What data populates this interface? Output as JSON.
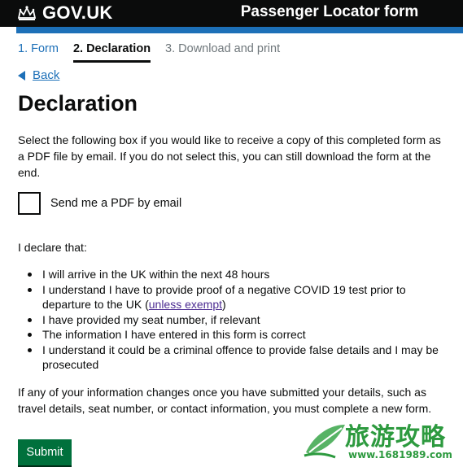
{
  "header": {
    "logo_text": "GOV.UK",
    "service_name": "Passenger Locator form"
  },
  "steps": [
    {
      "label": "1. Form"
    },
    {
      "label": "2. Declaration"
    },
    {
      "label": "3. Download and print"
    }
  ],
  "back_link": "Back",
  "page_title": "Declaration",
  "intro_text": "Select the following box if you would like to receive a copy of this completed form as a PDF file by email. If you do not select this, you can still download the form at the end.",
  "checkbox": {
    "label": "Send me a PDF by email",
    "checked": false
  },
  "declare_intro": "I declare that:",
  "declarations": {
    "item1": "I will arrive in the UK within the next 48 hours",
    "item2_before": "I understand I have to provide proof of a negative COVID 19 test prior to departure to the UK (",
    "item2_link": "unless exempt",
    "item2_after": ")",
    "item3": "I have provided my seat number, if relevant",
    "item4": "The information I have entered in this form is correct",
    "item5": "I understand it could be a criminal offence to provide false details and I may be prosecuted"
  },
  "outro_text": "If any of your information changes once you have submitted your details, such as travel details, seat number, or contact information, you must complete a new form.",
  "submit_label": "Submit",
  "watermark": {
    "title": "旅游攻略",
    "url": "www.1681989.com"
  },
  "colors": {
    "header_bg": "#0b0c0c",
    "accent_blue": "#1d70b8",
    "button_green": "#00703c",
    "visited_link": "#4c2c92"
  }
}
